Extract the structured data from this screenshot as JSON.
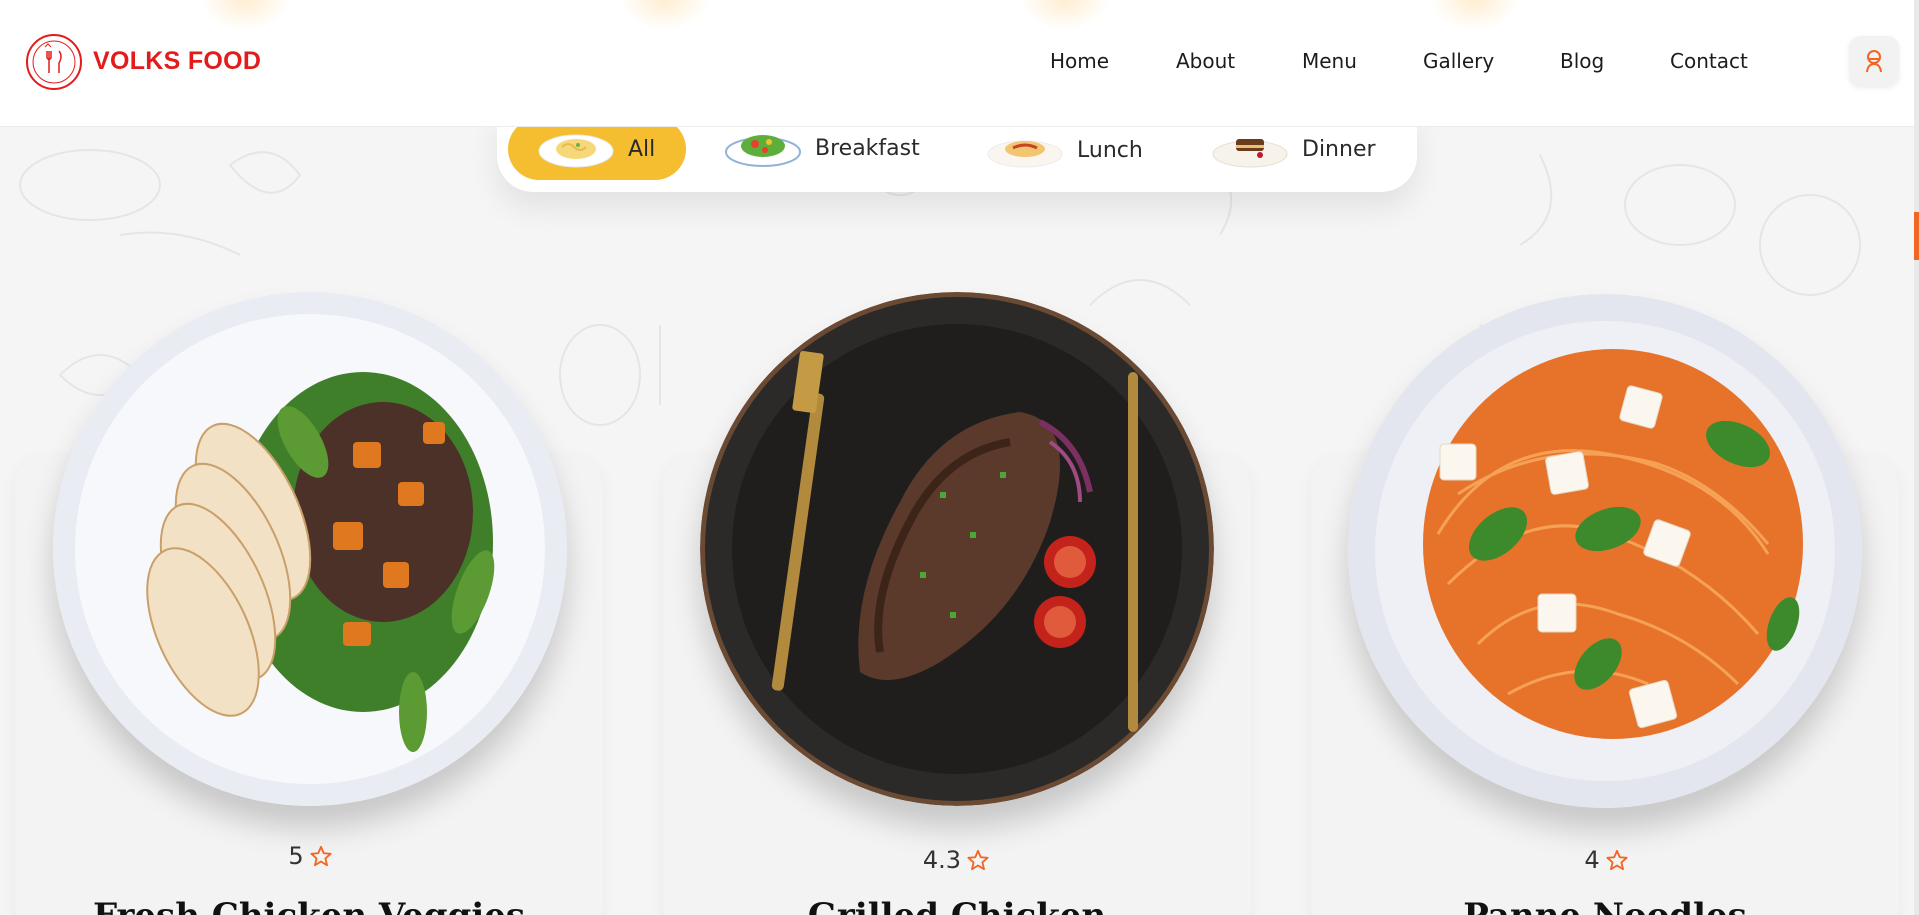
{
  "brand": {
    "name": "VOLKS FOOD",
    "logo_color": "#e31b1b",
    "icon": "restaurant-badge-icon"
  },
  "nav": {
    "items": [
      {
        "label": "Home"
      },
      {
        "label": "About"
      },
      {
        "label": "Menu"
      },
      {
        "label": "Gallery"
      },
      {
        "label": "Blog"
      },
      {
        "label": "Contact"
      }
    ],
    "user_icon": "chef-user-icon"
  },
  "filters": {
    "active_color": "#f4be30",
    "tabs": [
      {
        "label": "All",
        "active": true,
        "icon": "pasta-plate-icon"
      },
      {
        "label": "Breakfast",
        "active": false,
        "icon": "salad-plate-icon"
      },
      {
        "label": "Lunch",
        "active": false,
        "icon": "noodle-plate-icon"
      },
      {
        "label": "Dinner",
        "active": false,
        "icon": "cake-plate-icon"
      }
    ]
  },
  "dishes": [
    {
      "rating": "5",
      "name": "Fresh Chicken Veggies",
      "icon": "chicken-salad-plate"
    },
    {
      "rating": "4.3",
      "name": "Grilled Chicken",
      "icon": "steak-plate"
    },
    {
      "rating": "4",
      "name": "Panne Noodles",
      "icon": "spaghetti-plate"
    }
  ],
  "colors": {
    "accent": "#f26522",
    "star": "#f26522"
  }
}
